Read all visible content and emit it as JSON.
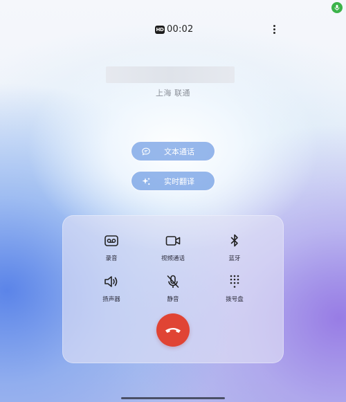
{
  "status": {
    "hd_badge": "HD",
    "timer": "00:02"
  },
  "caller": {
    "carrier": "上海 联通"
  },
  "quick_actions": {
    "text_call": "文本通话",
    "live_translate": "实时翻译"
  },
  "controls": {
    "record": "录音",
    "video_call": "视频通话",
    "bluetooth": "蓝牙",
    "speaker": "扬声器",
    "mute": "静音",
    "dialpad": "拨号盘"
  },
  "icons": {
    "more": "more-vertical-icon",
    "mic_indicator": "mic-icon",
    "record": "voicemail-icon",
    "video_call": "video-camera-icon",
    "bluetooth": "bluetooth-icon",
    "speaker": "speaker-icon",
    "mute": "mic-off-icon",
    "dialpad": "dialpad-icon",
    "end_call": "hang-up-icon"
  },
  "colors": {
    "end_call": "#e04434",
    "mic_indicator": "#3bb34a",
    "pill_fill": "#588cde"
  }
}
